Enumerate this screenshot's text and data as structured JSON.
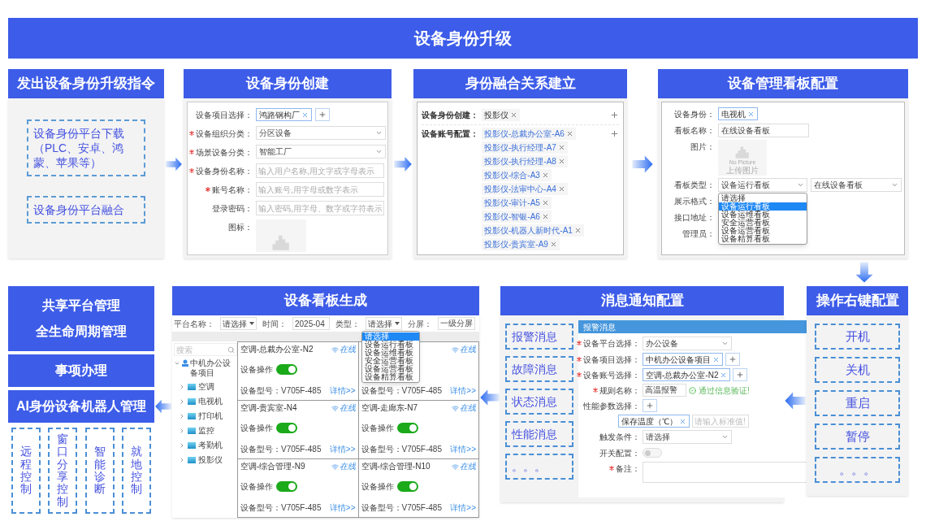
{
  "title": "设备身份升级",
  "issue_command": {
    "title": "发出设备身份升级指令",
    "items": [
      "设备身份平台下载（PLC、安卓、鸿蒙、苹果等）",
      "设备身份平台融合"
    ]
  },
  "identity_create": {
    "title": "设备身份创建",
    "fields": [
      {
        "label": "设备项目选择：",
        "required": false,
        "kind": "tag",
        "value": "鸿路钢构厂"
      },
      {
        "label": "设备组织分类：",
        "required": true,
        "kind": "select",
        "value": "分区设备"
      },
      {
        "label": "场景设备分类：",
        "required": true,
        "kind": "select",
        "value": "智能工厂"
      },
      {
        "label": "设备身份名称：",
        "required": true,
        "kind": "input",
        "placeholder": "输入用户名称,用文字或字母表示"
      },
      {
        "label": "账号名称：",
        "required": true,
        "kind": "input",
        "placeholder": "输入账号,用字母或数字表示"
      },
      {
        "label": "登录密码：",
        "required": false,
        "kind": "input",
        "placeholder": "输入密码,用字母、数字或字符表示"
      },
      {
        "label": "图标：",
        "required": false,
        "kind": "image"
      }
    ]
  },
  "fusion": {
    "title": "身份融合关系建立",
    "rows": [
      {
        "label": "设备身份创建：",
        "kind": "plain",
        "tags": [
          "投影仪"
        ]
      },
      {
        "label": "设备账号配置：",
        "kind": "link",
        "tags": [
          "投影仪-总裁办公室-A6",
          "投影仪-执行经理-A7",
          "投影仪-执行经理-A8",
          "投影仪-综合-A3",
          "投影仪-法审中心-A4",
          "投影仪-审计-A5",
          "投影仪-智银-A6",
          "投影仪-机器人新时代-A1",
          "投影仪-贵宾室-A9"
        ]
      }
    ]
  },
  "dashboard_config": {
    "title": "设备管理看板配置",
    "fields": [
      {
        "label": "设备身份：",
        "kind": "tag",
        "value": "电视机"
      },
      {
        "label": "看板名称：",
        "kind": "input",
        "value": "在线设备看板"
      },
      {
        "label": "图片：",
        "kind": "image",
        "caption": "No Picture",
        "subcaption": "上传图片"
      },
      {
        "label": "看板类型：",
        "kind": "select_pair",
        "value": "设备运行看板",
        "value2": "在线设备看板"
      },
      {
        "label": "展示格式：",
        "kind": "blank"
      },
      {
        "label": "接口地址：",
        "kind": "blank"
      },
      {
        "label": "管理员：",
        "kind": "blank"
      }
    ],
    "options": [
      {
        "label": "请选择",
        "selected": false
      },
      {
        "label": "设备运行看板",
        "selected": true
      },
      {
        "label": "设备运维看板",
        "selected": false
      },
      {
        "label": "安全运营看板",
        "selected": false
      },
      {
        "label": "设备运营看板",
        "selected": false
      },
      {
        "label": "设备精算看板",
        "selected": false
      }
    ]
  },
  "management": {
    "blocks": [
      {
        "lines": [
          "共享平台管理",
          "全生命周期管理"
        ]
      },
      {
        "lines": [
          "事项办理"
        ]
      },
      {
        "lines": [
          "AI身份设备机器人管理"
        ]
      }
    ],
    "actions": [
      "远程控制",
      "窗口分享控制",
      "智能诊断",
      "就地控制"
    ]
  },
  "dashboard_gen": {
    "title": "设备看板生成",
    "filters": [
      {
        "label": "平台名称：",
        "kind": "select",
        "value": "请选择"
      },
      {
        "label": "时间：",
        "kind": "input",
        "value": "2025-04"
      },
      {
        "label": "类型：",
        "kind": "select",
        "value": "请选择"
      },
      {
        "label": "分屏：",
        "kind": "input",
        "value": "一级分屏"
      }
    ],
    "options": [
      {
        "label": "请选择",
        "selected": true
      },
      {
        "label": "设备运行看板",
        "selected": false
      },
      {
        "label": "设备运维看板",
        "selected": false
      },
      {
        "label": "安全运营看板",
        "selected": false
      },
      {
        "label": "设备运营看板",
        "selected": false
      },
      {
        "label": "设备精算看板",
        "selected": false
      }
    ],
    "search_placeholder": "搜索",
    "tree": {
      "label": "中机办公设备项目",
      "expanded": true,
      "children": [
        {
          "label": "空调",
          "expanded": false
        },
        {
          "label": "电视机",
          "expanded": false
        },
        {
          "label": "打印机",
          "expanded": false
        },
        {
          "label": "监控",
          "expanded": false
        },
        {
          "label": "考勤机",
          "expanded": false
        },
        {
          "label": "投影仪",
          "expanded": false
        }
      ]
    },
    "cards": [
      {
        "name": "空调-总裁办公室-N2",
        "status": "在线",
        "switch_label": "设备操作",
        "on": true,
        "model": "设备型号：V705F-485",
        "link": "详情>>"
      },
      {
        "status": "在线",
        "model": "设备型号：V705F-485",
        "link": "详情>>"
      },
      {
        "name": "空调-贵宾室-N4",
        "status": "在线",
        "switch_label": "设备操作",
        "on": true,
        "model": "设备型号：V705F-485",
        "link": "详情>>"
      },
      {
        "name": "空调-走廊东-N7",
        "status": "在线",
        "switch_label": "设备操作",
        "on": true,
        "model": "设备型号：V705F-485",
        "link": "详情>>"
      },
      {
        "name": "空调-综合管理-N9",
        "status": "在线",
        "switch_label": "设备操作",
        "on": true,
        "model": "设备型号：V705F-485",
        "link": "详情>>"
      },
      {
        "name": "空调-综合管理-N10",
        "status": "在线",
        "switch_label": "设备操作",
        "on": true,
        "model": "设备型号：V705F-485",
        "link": "详情>>"
      }
    ]
  },
  "message_config": {
    "title": "消息通知配置",
    "types": [
      "报警消息",
      "故障消息",
      "状态消息",
      "性能消息",
      "。。。"
    ],
    "form": {
      "header": "报警消息",
      "fields": [
        {
          "label": "设备平台选择：",
          "required": true,
          "kind": "select",
          "value": "办公设备"
        },
        {
          "label": "设备项目选择：",
          "required": true,
          "kind": "tag",
          "value": "中机办公设备项目"
        },
        {
          "label": "设备账号选择：",
          "required": true,
          "kind": "tag",
          "value": "空调-总裁办公室-N2"
        },
        {
          "label": "规则名称：",
          "required": true,
          "kind": "input",
          "value": "高温报警",
          "note": "通过信息验证!"
        },
        {
          "label": "性能参数选择：",
          "required": false,
          "kind": "add"
        },
        {
          "kind": "tag_input",
          "value": "保存温度（℃）",
          "placeholder": "请输入标准值!"
        },
        {
          "label": "触发条件：",
          "required": false,
          "kind": "select",
          "value": "请选择"
        },
        {
          "label": "开关配置：",
          "required": false,
          "kind": "switch",
          "on": false
        },
        {
          "label": "备注：",
          "required": true,
          "kind": "textarea"
        }
      ]
    }
  },
  "operations": {
    "title": "操作右键配置",
    "items": [
      "开机",
      "关机",
      "重启",
      "暂停",
      "。。。"
    ]
  }
}
